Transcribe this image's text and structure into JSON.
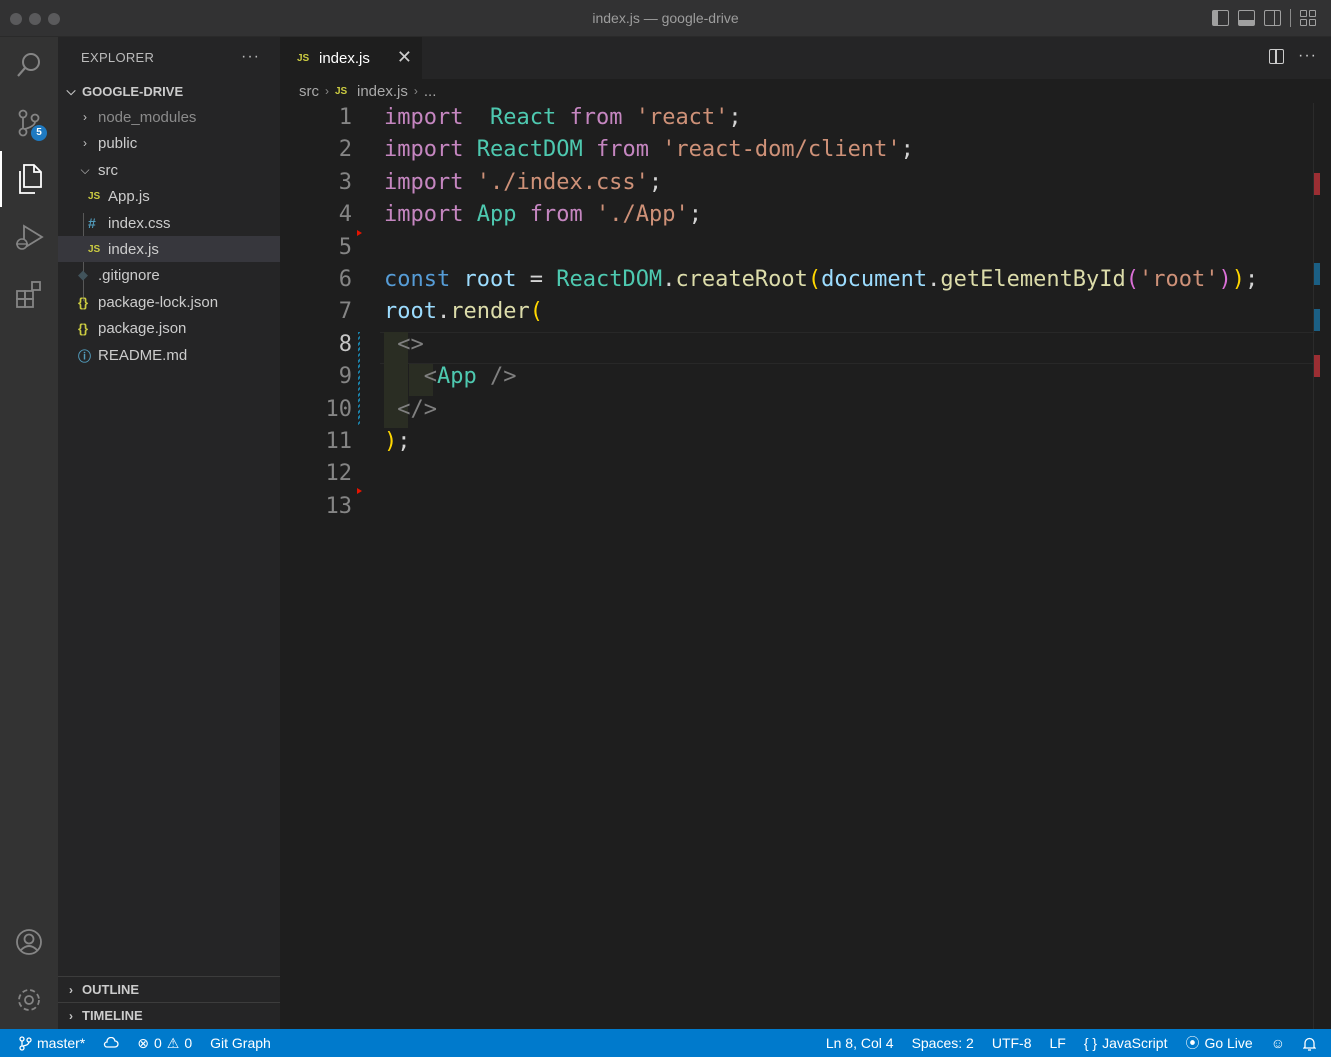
{
  "window": {
    "title": "index.js — google-drive"
  },
  "activity_bar": {
    "scm_badge": "5"
  },
  "explorer": {
    "header": "EXPLORER",
    "more": "···",
    "root_folder": "GOOGLE-DRIVE",
    "items": [
      {
        "label": "node_modules",
        "type": "folder",
        "state": "collapsed"
      },
      {
        "label": "public",
        "type": "folder",
        "state": "collapsed"
      },
      {
        "label": "src",
        "type": "folder",
        "state": "expanded"
      },
      {
        "label": "App.js",
        "type": "js"
      },
      {
        "label": "index.css",
        "type": "css"
      },
      {
        "label": "index.js",
        "type": "js",
        "selected": true
      },
      {
        "label": ".gitignore",
        "type": "git"
      },
      {
        "label": "package-lock.json",
        "type": "json"
      },
      {
        "label": "package.json",
        "type": "json"
      },
      {
        "label": "README.md",
        "type": "info"
      }
    ],
    "outline": "OUTLINE",
    "timeline": "TIMELINE"
  },
  "tabs": [
    {
      "label": "index.js",
      "icon": "JS"
    }
  ],
  "breadcrumb": {
    "folder": "src",
    "file": "index.js",
    "more": "..."
  },
  "editor": {
    "current_line": 8,
    "line_numbers": [
      "1",
      "2",
      "3",
      "4",
      "5",
      "6",
      "7",
      "8",
      "9",
      "10",
      "11",
      "12",
      "13"
    ],
    "lines": [
      [
        [
          "kw",
          "import"
        ],
        [
          "",
          "  "
        ],
        [
          "cls",
          "React"
        ],
        [
          "",
          " "
        ],
        [
          "kw",
          "from"
        ],
        [
          "",
          " "
        ],
        [
          "str",
          "'react'"
        ],
        [
          "",
          ";"
        ]
      ],
      [
        [
          "kw",
          "import"
        ],
        [
          "",
          " "
        ],
        [
          "cls",
          "ReactDOM"
        ],
        [
          "",
          " "
        ],
        [
          "kw",
          "from"
        ],
        [
          "",
          " "
        ],
        [
          "str",
          "'react-dom/client'"
        ],
        [
          "",
          ";"
        ]
      ],
      [
        [
          "kw",
          "import"
        ],
        [
          "",
          " "
        ],
        [
          "str",
          "'./index.css'"
        ],
        [
          "",
          ";"
        ]
      ],
      [
        [
          "kw",
          "import"
        ],
        [
          "",
          " "
        ],
        [
          "cls",
          "App"
        ],
        [
          "",
          " "
        ],
        [
          "kw",
          "from"
        ],
        [
          "",
          " "
        ],
        [
          "str",
          "'./App'"
        ],
        [
          "",
          ";"
        ]
      ],
      [],
      [
        [
          "const",
          "const"
        ],
        [
          "",
          " "
        ],
        [
          "var",
          "root"
        ],
        [
          "",
          " = "
        ],
        [
          "cls",
          "ReactDOM"
        ],
        [
          "",
          "."
        ],
        [
          "fn",
          "createRoot"
        ],
        [
          "brk1",
          "("
        ],
        [
          "var",
          "document"
        ],
        [
          "",
          "."
        ],
        [
          "fn",
          "getElementById"
        ],
        [
          "brk2",
          "("
        ],
        [
          "str",
          "'root'"
        ],
        [
          "brk2",
          ")"
        ],
        [
          "brk1",
          ")"
        ],
        [
          "",
          ";"
        ]
      ],
      [
        [
          "var",
          "root"
        ],
        [
          "",
          "."
        ],
        [
          "fn",
          "render"
        ],
        [
          "brk1",
          "("
        ]
      ],
      [
        [
          "",
          " "
        ],
        [
          "tag",
          "<>"
        ]
      ],
      [
        [
          "",
          "   "
        ],
        [
          "tag",
          "<"
        ],
        [
          "cls",
          "App"
        ],
        [
          "",
          " "
        ],
        [
          "tag",
          "/>"
        ]
      ],
      [
        [
          "",
          " "
        ],
        [
          "tag",
          "</>"
        ]
      ],
      [
        [
          "brk1",
          ")"
        ],
        [
          "",
          ";"
        ]
      ],
      [],
      []
    ]
  },
  "status_bar": {
    "branch": "master*",
    "errors": "0",
    "warnings": "0",
    "git_graph": "Git Graph",
    "position": "Ln 8, Col 4",
    "spaces": "Spaces: 2",
    "encoding": "UTF-8",
    "eol": "LF",
    "language": "JavaScript",
    "go_live": "Go Live"
  },
  "colors": {
    "accent": "#007acc",
    "keyword": "#c586c0",
    "string": "#ce9178",
    "class": "#4ec9b0",
    "variable": "#9cdcfe",
    "function": "#dcdcaa"
  }
}
